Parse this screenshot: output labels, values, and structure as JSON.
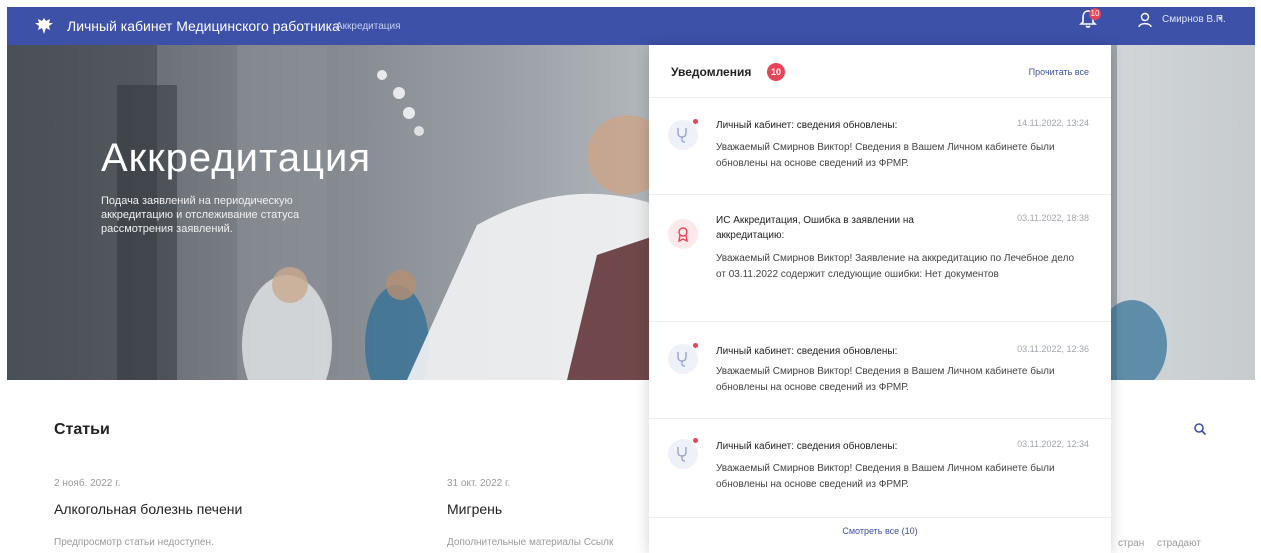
{
  "header": {
    "app_title": "Личный кабинет Медицинского работника",
    "nav_link": "Аккредитация",
    "bell_badge": "10",
    "user_name": "Смирнов В.П.",
    "user_caret": "▾"
  },
  "hero": {
    "title": "Аккредитация",
    "subtitle": "Подача заявлений на периодическую аккредитацию и отслеживание статуса рассмотрения заявлений."
  },
  "articles": {
    "heading": "Статьи",
    "items": [
      {
        "date": "2 нояб. 2022 г.",
        "title": "Алкогольная болезнь печени",
        "text": "Предпросмотр статьи недоступен."
      },
      {
        "date": "31 окт. 2022 г.",
        "title": "Мигрень",
        "text": "Дополнительные материалы Ссылк"
      }
    ],
    "tail_text_1": "стран",
    "tail_text_2": "страдают"
  },
  "notifications": {
    "title": "Уведомления",
    "count": "10",
    "read_all": "Прочитать все",
    "see_all": "Смотреть все (10)",
    "items": [
      {
        "icon": "stethoscope-icon",
        "title": "Личный кабинет: сведения обновлены:",
        "time": "14.11.2022, 13:24",
        "body": "Уважаемый Смирнов Виктор! Сведения в Вашем Личном кабинете были обновлены на основе сведений из ФРМР."
      },
      {
        "icon": "award-icon",
        "title": "ИС Аккредитация, Ошибка в заявлении на аккредитацию:",
        "time": "03.11.2022, 18:38",
        "body": "Уважаемый Смирнов Виктор! Заявление на аккредитацию по Лечебное дело от 03.11.2022 содержит следующие ошибки: Нет документов"
      },
      {
        "icon": "stethoscope-icon",
        "title": "Личный кабинет: сведения обновлены:",
        "time": "03.11.2022, 12:36",
        "body": "Уважаемый Смирнов Виктор! Сведения в Вашем Личном кабинете были обновлены на основе сведений из ФРМР."
      },
      {
        "icon": "stethoscope-icon",
        "title": "Личный кабинет: сведения обновлены:",
        "time": "03.11.2022, 12:34",
        "body": "Уважаемый Смирнов Виктор! Сведения в Вашем Личном кабинете были обновлены на основе сведений из ФРМР."
      }
    ]
  },
  "colors": {
    "brand": "#3d51a8",
    "badge": "#e64457"
  }
}
